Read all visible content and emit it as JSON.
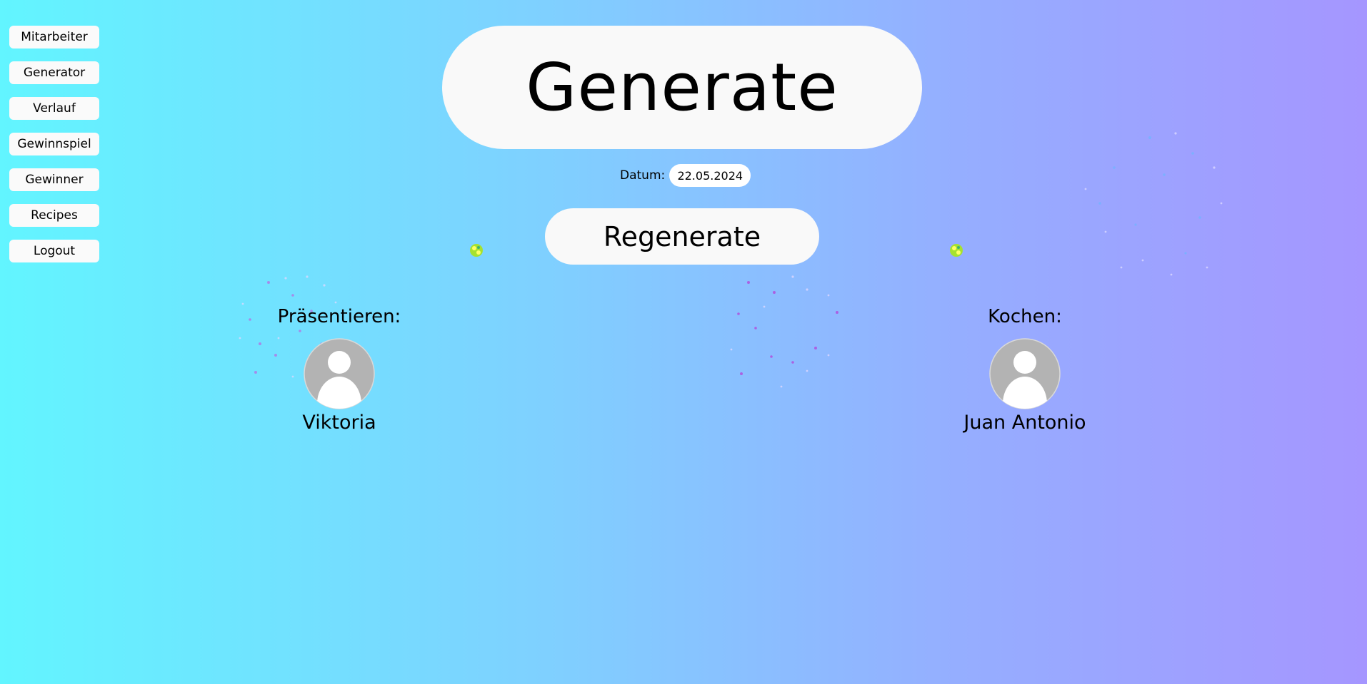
{
  "sidebar": {
    "items": [
      {
        "label": "Mitarbeiter"
      },
      {
        "label": "Generator"
      },
      {
        "label": "Verlauf"
      },
      {
        "label": "Gewinnspiel"
      },
      {
        "label": "Gewinner"
      },
      {
        "label": "Recipes"
      },
      {
        "label": "Logout"
      }
    ]
  },
  "header": {
    "title": "Generate"
  },
  "datum": {
    "label": "Datum:",
    "value": "22.05.2024"
  },
  "regenerate": {
    "label": "Regenerate"
  },
  "assignments": [
    {
      "role": "Präsentieren:",
      "name": "Viktoria",
      "avatar_icon": "user-avatar-icon"
    },
    {
      "role": "Kochen:",
      "name": "Juan Antonio",
      "avatar_icon": "user-avatar-icon"
    }
  ],
  "colors": {
    "gradient_start": "#62f5ff",
    "gradient_end": "#a596ff",
    "button_bg": "#f9f9f9",
    "avatar_bg": "#b3b3b3"
  }
}
